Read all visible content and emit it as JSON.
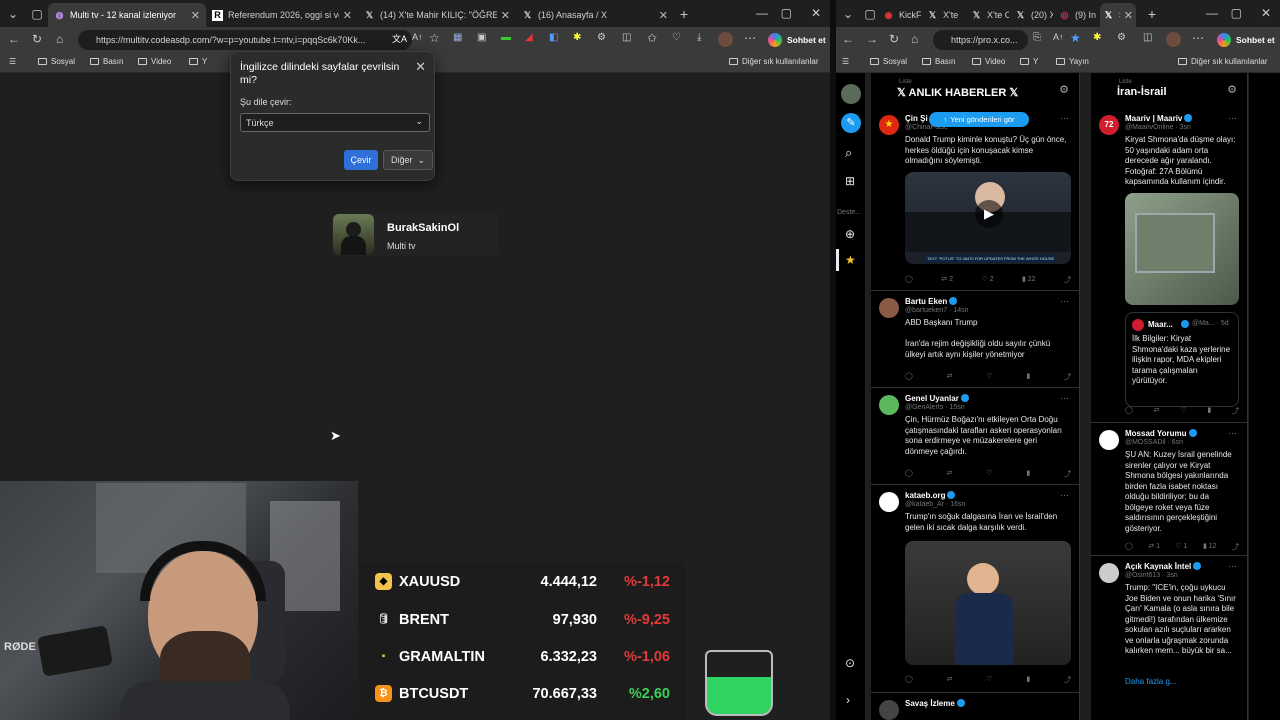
{
  "left_browser": {
    "tabs": [
      {
        "label": "Multi tv - 12 kanal izleniyor",
        "icon": "multitv-icon",
        "active": true
      },
      {
        "label": "Referendum 2026, oggi si vota: le",
        "icon": "r-icon"
      },
      {
        "label": "(14) X'te Mahir KILIÇ: \"ÖĞRENCİ A",
        "icon": "x-icon"
      },
      {
        "label": "(16) Anasayfa / X",
        "icon": "x-icon"
      }
    ],
    "url": "https://multitv.codeasdp.com/?w=p=youtube.t=ntv,i=pqqSc6k70Kk...",
    "bookmarks": [
      "Sosyal",
      "Basın",
      "Video",
      "Y"
    ],
    "other_bookmarks": "Diğer sık kullanılanlar",
    "chat_label": "Sohbet et"
  },
  "translate_popup": {
    "title": "İngilizce dilindeki sayfalar çevrilsin mi?",
    "label": "Şu dile çevir:",
    "selected_language": "Türkçe",
    "translate_button": "Çevir",
    "more_button": "Diğer"
  },
  "channel_card": {
    "name": "BurakSakinOl",
    "subtitle": "Multi tv"
  },
  "ticker": [
    {
      "symbol": "XAUUSD",
      "price": "4.444,12",
      "change": "%-1,12",
      "color": "#e23a3a",
      "icon_color": "#f2c14e"
    },
    {
      "symbol": "BRENT",
      "price": "97,930",
      "change": "%-9,25",
      "color": "#e23a3a",
      "icon_color": "#dddddd"
    },
    {
      "symbol": "GRAMALTIN",
      "price": "6.332,23",
      "change": "%-1,06",
      "color": "#e23a3a",
      "icon_color": "#f2c14e"
    },
    {
      "symbol": "BTCUSDT",
      "price": "70.667,33",
      "change": "%2,60",
      "color": "#3ecf5a",
      "icon_color": "#f7931a"
    }
  ],
  "webcam_label": "RØDE",
  "right_browser": {
    "tabs": [
      "KickF",
      "X'te",
      "X'te C",
      "(20) X",
      "(9) In",
      "S"
    ],
    "url": "https://pro.x.co...",
    "bookmarks": [
      "Sosyal",
      "Basın",
      "Video",
      "Y",
      "Yayın"
    ],
    "other_bookmarks": "Diğer sık kullanılanlar",
    "chat_label": "Sohbet et"
  },
  "x_sidebar": {
    "highlight_label": "Deste..."
  },
  "col1": {
    "small": "Liste",
    "title": "𝕏 ANLIK HABERLER 𝕏",
    "new_posts": "Yeni gönderileri gör",
    "tweets": [
      {
        "name": "Çin Şi",
        "handle": "@ChinaPulse",
        "text": "Donald Trump kiminle konuştu? Üç gün önce, herkes öldüğü için konuşacak kimse olmadığını söylemişti.",
        "stats": [
          "",
          "2",
          "2",
          "22",
          ""
        ],
        "media_caption": "TEXT \"POTUS\" TO 45470 FOR UPDATES FROM THE WHITE HOUSE"
      },
      {
        "name": "Bartu Eken",
        "handle": "@bartueken7 · 14sn",
        "text": "ABD Başkanı Trump\n\nİran'da rejim değişikliği oldu sayılır çünkü ülkeyi artık aynı kişiler yönetmiyor",
        "stats": [
          "",
          "",
          "",
          "",
          ""
        ]
      },
      {
        "name": "Genel Uyanlar",
        "handle": "@GenAlerts · 15sn",
        "text": "Çin, Hürmüz Boğazı'nı etkileyen Orta Doğu çatışmasındaki tarafları askeri operasyonları sona erdirmeye ve müzakerelere geri dönmeye çağırdı.",
        "stats": [
          "",
          "",
          "",
          "",
          ""
        ]
      },
      {
        "name": "kataeb.org",
        "handle": "@kataeb_Ar · 16sn",
        "text": "Trump'ın soğuk dalgasına İran ve İsrail'den gelen iki sıcak dalga karşılık verdi.",
        "stats": [
          "",
          "",
          "",
          "",
          ""
        ]
      },
      {
        "name": "Savaş İzleme",
        "handle": "",
        "text": "",
        "stats": []
      }
    ]
  },
  "col2": {
    "small": "Liste",
    "title": "İran-İsrail",
    "tweets": [
      {
        "name": "Maariv | Maariv",
        "handle": "@MaarivOnline · 3sn",
        "text": "Kiryat Shmona'da düşme olayı: 50 yaşındaki adam orta derecede ağır yaralandı. Fotoğraf: 27A Bölümü kapsamında kullanım içindir.",
        "quote_name": "Maar...",
        "quote_handle": "@Ma... · 5d",
        "quote_text": "İlk Bilgiler: Kiryat Shmona'daki kaza yerlerine ilişkin rapor, MDA ekipleri tarama çalışmaları yürütüyor.",
        "stats": []
      },
      {
        "name": "Mossad Yorumu",
        "handle": "@MOSSADil · 6sn",
        "text": "ŞU AN: Kuzey İsrail genelinde sirenler çalıyor ve Kiryat Shmona bölgesi yakınlarında birden fazla isabet noktası olduğu bildiriliyor; bu da bölgeye roket veya füze saldırısının gerçekleştiğini gösteriyor.",
        "stats": [
          "",
          "1",
          "1",
          "12",
          ""
        ]
      },
      {
        "name": "Açık Kaynak İntel",
        "handle": "@Osint613 · 3sn",
        "text": "Trump: \"ICE'in, çoğu uykucu Joe Biden ve onun harika 'Sınır Çarı' Kamala (o asla sınıra bile gitmedi!) tarafından ülkemize sokulan azılı suçluları ararken ve onlarla uğraşmak zorunda kalırken mem... büyük bir sa...",
        "more": "Daha fazla g...",
        "stats": []
      }
    ]
  }
}
